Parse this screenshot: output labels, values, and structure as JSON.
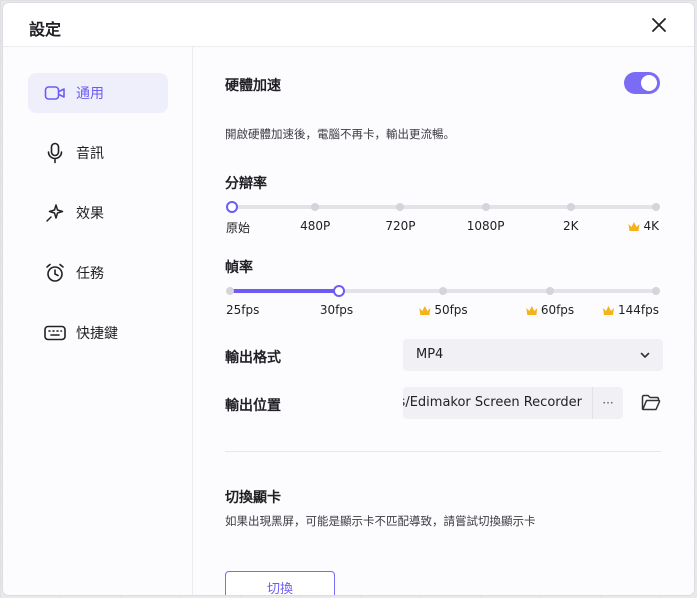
{
  "dialog": {
    "title": "設定"
  },
  "sidebar": {
    "items": [
      {
        "label": "通用",
        "icon": "camera-icon",
        "active": true
      },
      {
        "label": "音訊",
        "icon": "microphone-icon",
        "active": false
      },
      {
        "label": "效果",
        "icon": "sparkle-icon",
        "active": false
      },
      {
        "label": "任務",
        "icon": "alarm-clock-icon",
        "active": false
      },
      {
        "label": "快捷鍵",
        "icon": "keyboard-icon",
        "active": false
      }
    ]
  },
  "hw_accel": {
    "title": "硬體加速",
    "enabled": true,
    "description": "開啟硬體加速後，電腦不再卡，輸出更流暢。"
  },
  "resolution": {
    "title": "分辯率",
    "options": [
      "原始",
      "480P",
      "720P",
      "1080P",
      "2K",
      "4K"
    ],
    "premium": [
      false,
      false,
      false,
      false,
      false,
      true
    ],
    "selected_index": 0
  },
  "framerate": {
    "title": "幀率",
    "options": [
      "25fps",
      "30fps",
      "50fps",
      "60fps",
      "144fps"
    ],
    "premium": [
      false,
      false,
      true,
      true,
      true
    ],
    "selected_index": 1
  },
  "output_format": {
    "label": "輸出格式",
    "value": "MP4"
  },
  "output_location": {
    "label": "輸出位置",
    "path": "eos/Edimakor Screen Recorder",
    "more_label": "···"
  },
  "graphics_switch": {
    "title": "切換顯卡",
    "description": "如果出現黑屏，可能是顯示卡不匹配導致，請嘗試切換顯示卡",
    "button_label": "切換"
  },
  "colors": {
    "accent": "#6c5cf5",
    "toggle_on": "#7b6cf6",
    "crown": "#f5b21a"
  }
}
